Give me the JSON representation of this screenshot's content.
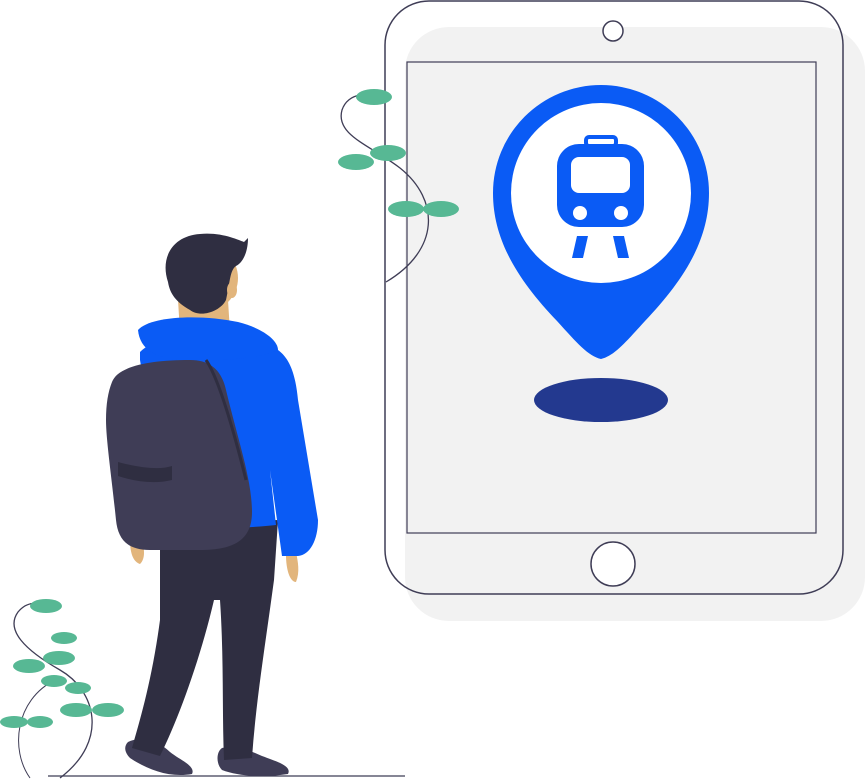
{
  "illustration": {
    "subject": "",
    "colors": {
      "accent_blue": "#0a5bf5",
      "shadow_navy": "#23398f",
      "tablet_shadow": "#f2f2f2",
      "tablet_frame": "#3f3d56",
      "screen_fill": "#f2f2f2",
      "leaf_green": "#57b894",
      "hair": "#2f2e41",
      "skin": "#e2b57c",
      "backpack": "#3f3d56",
      "pants": "#2f2e41"
    },
    "icons": [
      "map-pin-icon",
      "train-icon"
    ]
  }
}
